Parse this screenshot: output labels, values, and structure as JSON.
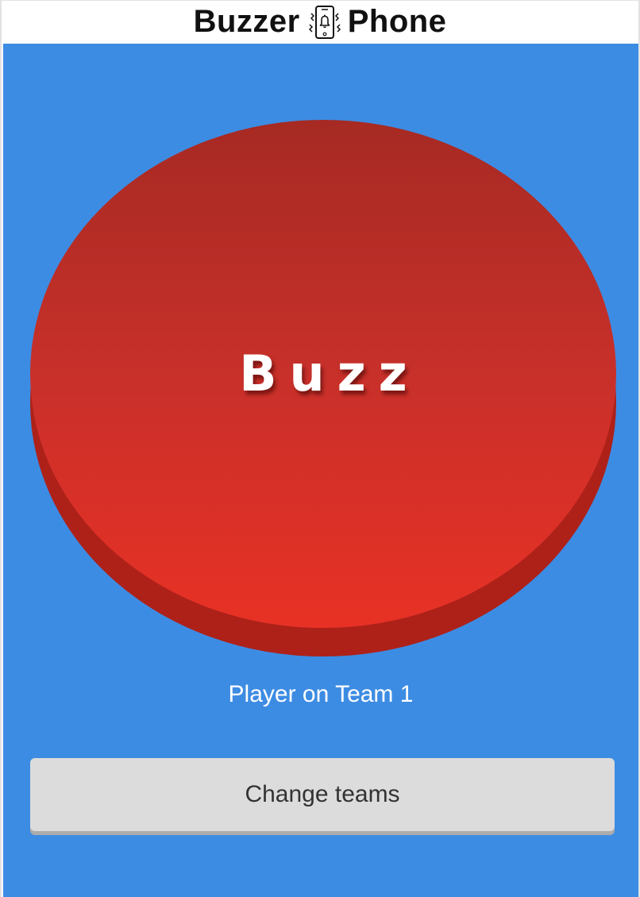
{
  "header": {
    "title_left": "Buzzer",
    "title_right": "Phone",
    "icon": "vibrating-phone-bell-icon"
  },
  "buzzer": {
    "label": "Buzz",
    "color": "#d32f2a"
  },
  "status": {
    "player_text": "Player on Team 1"
  },
  "actions": {
    "change_teams_label": "Change teams"
  },
  "colors": {
    "background": "#3d8ce3",
    "button_gray": "#dcdcdc",
    "buzzer_dark": "#ad2119"
  }
}
